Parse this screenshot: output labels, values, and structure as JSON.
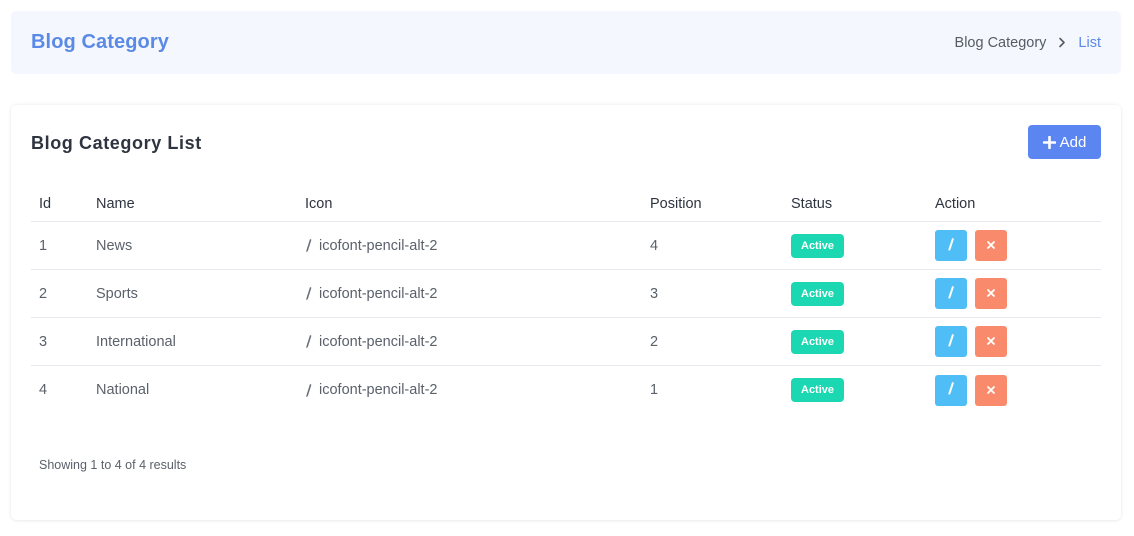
{
  "header": {
    "title": "Blog Category",
    "breadcrumb": {
      "parent": "Blog Category",
      "current": "List"
    }
  },
  "card": {
    "title": "Blog Category List",
    "add_label": "Add"
  },
  "table": {
    "columns": {
      "id": "Id",
      "name": "Name",
      "icon": "Icon",
      "position": "Position",
      "status": "Status",
      "action": "Action"
    },
    "rows": [
      {
        "id": "1",
        "name": "News",
        "icon": "icofont-pencil-alt-2",
        "position": "4",
        "status": "Active"
      },
      {
        "id": "2",
        "name": "Sports",
        "icon": "icofont-pencil-alt-2",
        "position": "3",
        "status": "Active"
      },
      {
        "id": "3",
        "name": "International",
        "icon": "icofont-pencil-alt-2",
        "position": "2",
        "status": "Active"
      },
      {
        "id": "4",
        "name": "National",
        "icon": "icofont-pencil-alt-2",
        "position": "1",
        "status": "Active"
      }
    ]
  },
  "footer": {
    "results": "Showing 1 to 4 of 4 results"
  },
  "colors": {
    "accent": "#5a8ae6",
    "add_button": "#5b86f2",
    "status_active": "#1cd8b2",
    "edit_button": "#4fbdf6",
    "delete_button": "#f98b6c"
  },
  "icons": {
    "breadcrumb_separator": "chevron-right-icon",
    "add": "plus-icon",
    "row_icon": "pencil-icon",
    "edit": "pencil-icon",
    "delete": "close-icon"
  }
}
